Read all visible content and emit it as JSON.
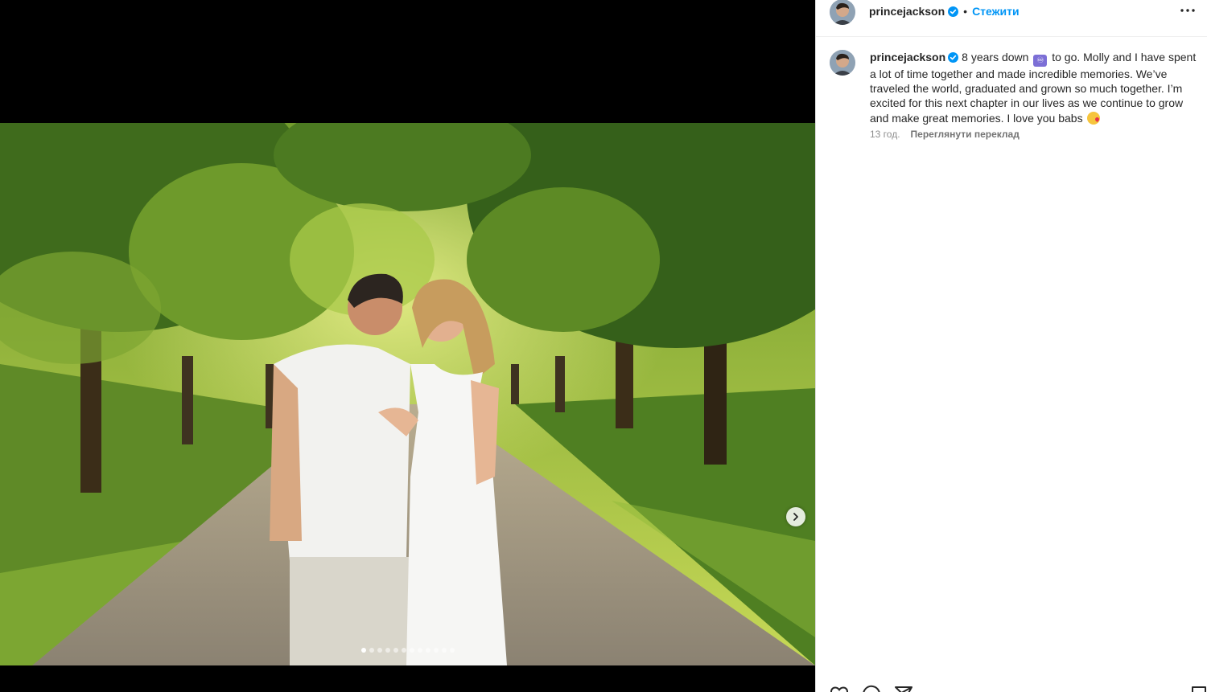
{
  "post": {
    "username": "princejackson",
    "follow_label": "Стежити",
    "separator": "•",
    "caption_before": "8 years down",
    "caption_emoji": "♾",
    "caption_after": "to go. Molly and I have spent a lot of time together and made incredible memories. We’ve traveled the world, graduated and grown so much together. I’m excited for this next chapter in our lives as we continue to grow and make great memories. I love you babs",
    "time_ago": "13 год.",
    "translate_label": "Переглянути переклад"
  },
  "carousel": {
    "slide_count": 12,
    "current_slide": 1
  },
  "colors": {
    "link_blue": "#0095f6",
    "verified_blue": "#0095f6",
    "text": "#262626",
    "muted": "#8e8e8e"
  },
  "icons": [
    "verified-badge-icon",
    "more-options-icon",
    "next-slide-icon",
    "like-icon",
    "comment-icon",
    "share-icon",
    "save-icon"
  ]
}
